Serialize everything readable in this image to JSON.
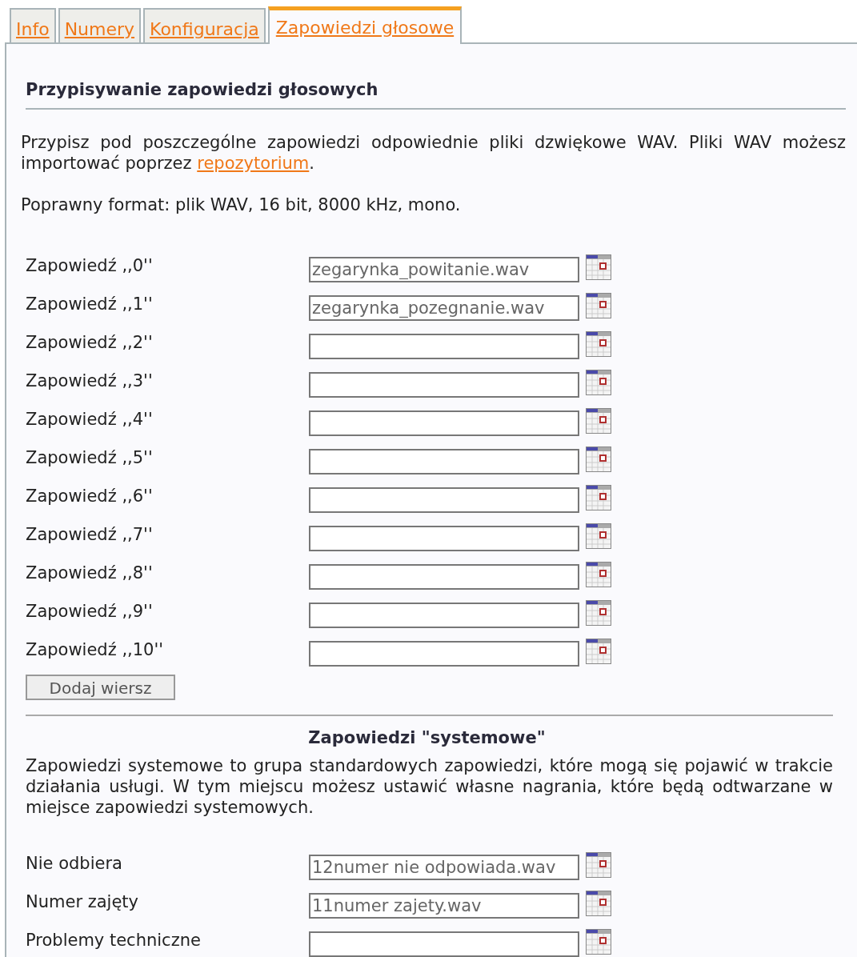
{
  "tabs": [
    {
      "label": "Info",
      "selected": false
    },
    {
      "label": "Numery",
      "selected": false
    },
    {
      "label": "Konfiguracja",
      "selected": false
    },
    {
      "label": "Zapowiedzi głosowe",
      "selected": true
    }
  ],
  "heading": "Przypisywanie zapowiedzi głosowych",
  "intro": {
    "text_before": "Przypisz pod poszczególne zapowiedzi odpowiednie pliki dzwiękowe WAV. Pliki WAV możesz importować poprzez ",
    "link": "repozytorium",
    "text_after": "."
  },
  "format_note": "Poprawny format: plik WAV, 16 bit, 8000 kHz, mono.",
  "announcements": [
    {
      "label": "Zapowiedź ,,0''",
      "value": "zegarynka_powitanie.wav"
    },
    {
      "label": "Zapowiedź ,,1''",
      "value": "zegarynka_pozegnanie.wav"
    },
    {
      "label": "Zapowiedź ,,2''"
    },
    {
      "label": "Zapowiedź ,,3''"
    },
    {
      "label": "Zapowiedź ,,4''"
    },
    {
      "label": "Zapowiedź ,,5''"
    },
    {
      "label": "Zapowiedź ,,6''"
    },
    {
      "label": "Zapowiedź ,,7''"
    },
    {
      "label": "Zapowiedź ,,8''"
    },
    {
      "label": "Zapowiedź ,,9''"
    },
    {
      "label": "Zapowiedź ,,10''"
    }
  ],
  "add_row_button": "Dodaj wiersz",
  "system": {
    "title": "Zapowiedzi \"systemowe\"",
    "description": "Zapowiedzi systemowe to grupa standardowych zapowiedzi, które mogą się pojawić w trakcie działania usługi. W tym miejscu możesz ustawić własne nagrania, które będą odtwarzane w miejsce zapowiedzi systemowych.",
    "items": [
      {
        "label": "Nie odbiera",
        "value": "12numer nie odpowiada.wav"
      },
      {
        "label": "Numer zajęty",
        "value": "11numer zajety.wav"
      },
      {
        "label": "Problemy techniczne"
      }
    ]
  }
}
